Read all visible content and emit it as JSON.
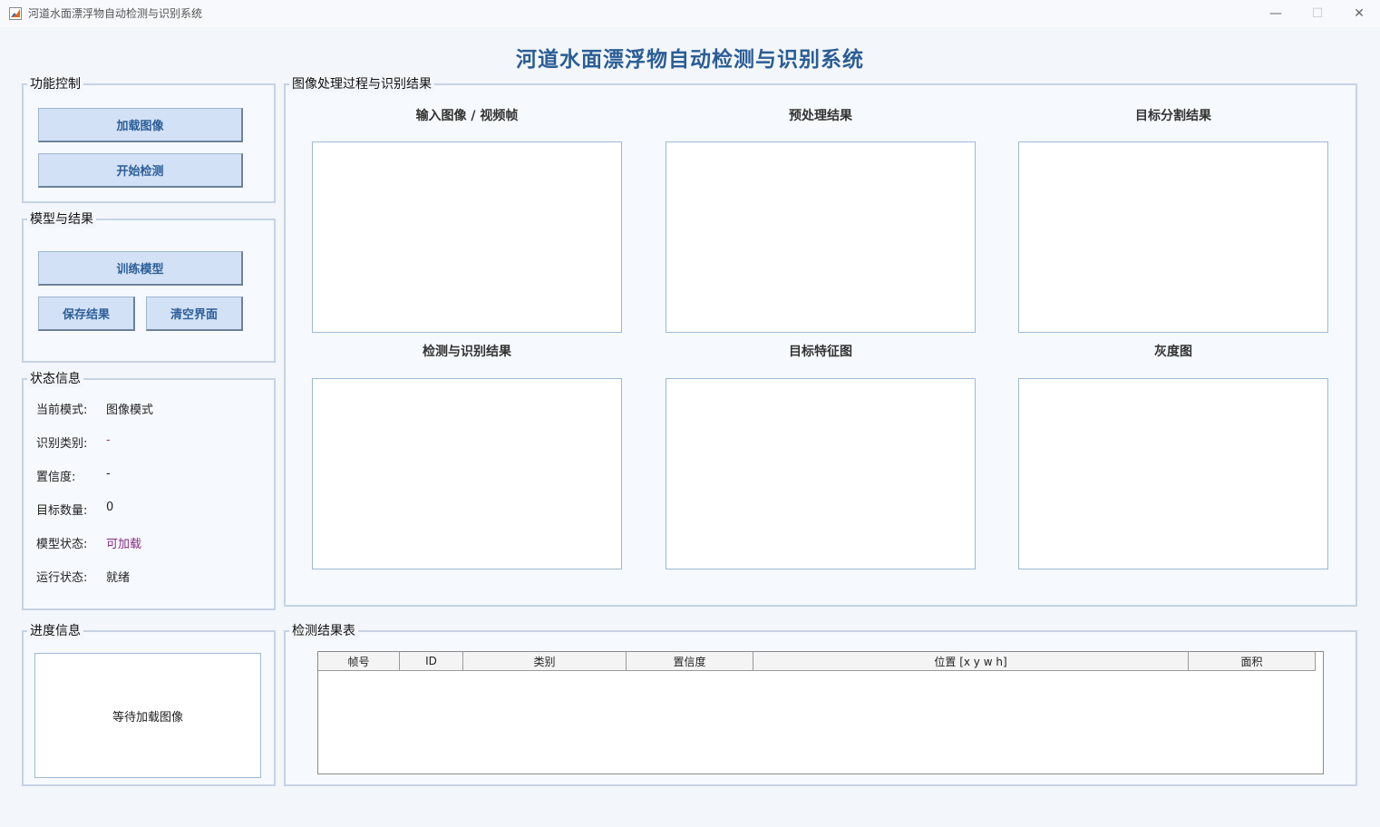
{
  "window": {
    "title": "河道水面漂浮物自动检测与识别系统",
    "minimize_glyph": "—",
    "maximize_glyph": "☐",
    "close_glyph": "✕"
  },
  "header": {
    "title": "河道水面漂浮物自动检测与识别系统"
  },
  "function_panel": {
    "title": "功能控制",
    "load_image": "加载图像",
    "start_detect": "开始检测"
  },
  "model_panel": {
    "title": "模型与结果",
    "train_model": "训练模型",
    "save_result": "保存结果",
    "clear_ui": "清空界面"
  },
  "status_panel": {
    "title": "状态信息",
    "rows": [
      {
        "label": "当前模式:",
        "value": "图像模式",
        "color": "#222222"
      },
      {
        "label": "识别类别:",
        "value": "-",
        "color": "#b0306a"
      },
      {
        "label": "置信度:",
        "value": "-",
        "color": "#222222"
      },
      {
        "label": "目标数量:",
        "value": "0",
        "color": "#222222"
      },
      {
        "label": "模型状态:",
        "value": "可加载",
        "color": "#8a2a86"
      },
      {
        "label": "运行状态:",
        "value": "就绪",
        "color": "#222222"
      }
    ]
  },
  "process_panel": {
    "title": "图像处理过程与识别结果",
    "captions": [
      "输入图像  /  视频帧",
      "预处理结果",
      "目标分割结果",
      "检测与识别结果",
      "目标特征图",
      "灰度图"
    ]
  },
  "progress_panel": {
    "title": "进度信息",
    "message": "等待加载图像"
  },
  "results_table": {
    "title": "检测结果表",
    "columns": [
      "帧号",
      "ID",
      "类别",
      "置信度",
      "位置 [x y w h]",
      "面积"
    ]
  },
  "colors": {
    "accent": "#2a5d96",
    "button_bg": "#d3e1f6",
    "panel_border": "#c5d3e4"
  }
}
